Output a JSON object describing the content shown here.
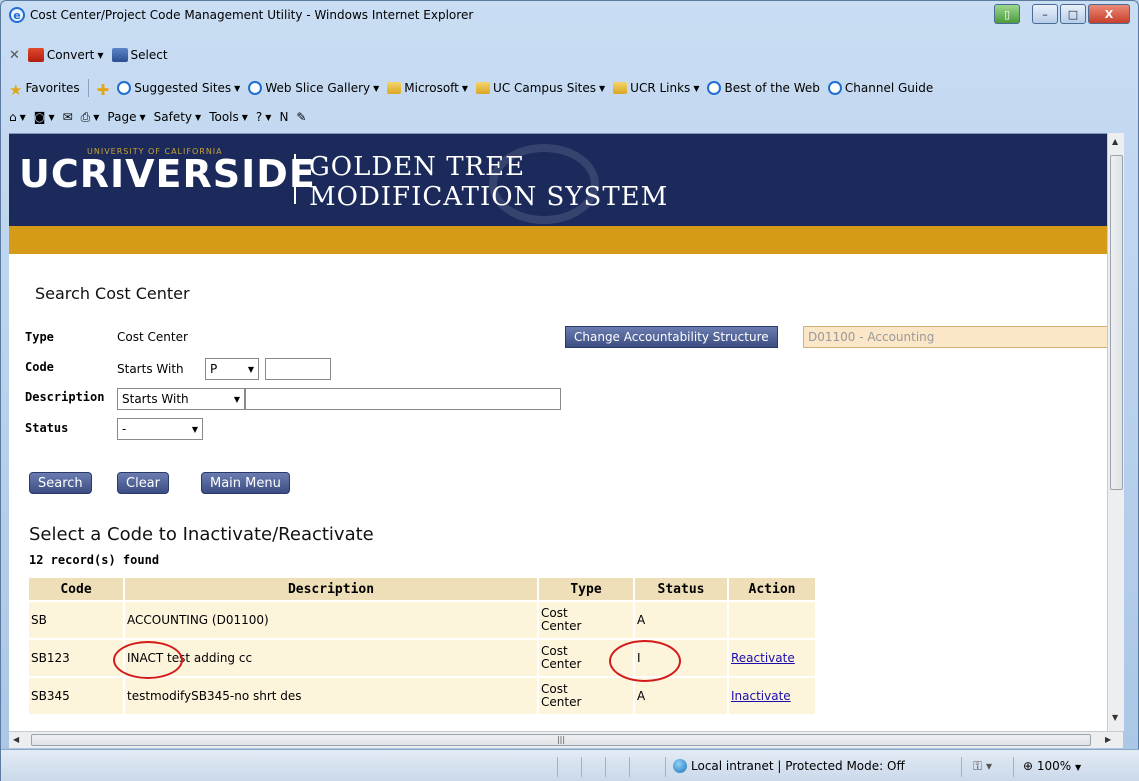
{
  "window": {
    "title": "Cost Center/Project Code Management Utility - Windows Internet Explorer",
    "btn_minimize": "–",
    "btn_maximize": "□",
    "btn_close": "X"
  },
  "toolbar": {
    "convert": "Convert",
    "select": "Select"
  },
  "favorites_bar": {
    "favorites": "Favorites",
    "items": [
      "Suggested Sites",
      "Web Slice Gallery",
      "Microsoft",
      "UC Campus Sites",
      "UCR Links",
      "Best of the Web",
      "Channel Guide"
    ]
  },
  "command_bar": {
    "page": "Page",
    "safety": "Safety",
    "tools": "Tools"
  },
  "banner": {
    "logo_uc": "UCRIVERSIDE",
    "logo_small": "UNIVERSITY OF CALIFORNIA",
    "system_line1": "GOLDEN TREE",
    "system_line2": "MODIFICATION SYSTEM"
  },
  "search": {
    "heading": "Search Cost Center",
    "type_label": "Type",
    "type_value": "Cost Center",
    "code_label": "Code",
    "code_prefix": "Starts With",
    "code_select": "P",
    "description_label": "Description",
    "description_select": "Starts With",
    "status_label": "Status",
    "status_select": "-",
    "btn_search": "Search",
    "btn_clear": "Clear",
    "btn_main_menu": "Main Menu",
    "btn_change_structure": "Change Accountability Structure",
    "structure_value": "D01100 - Accounting"
  },
  "results": {
    "heading": "Select a Code to Inactivate/Reactivate",
    "found": "12 record(s) found",
    "columns": [
      "Code",
      "Description",
      "Type",
      "Status",
      "Action"
    ],
    "rows": [
      {
        "code": "SB",
        "description": "ACCOUNTING (D01100)",
        "type_line1": "Cost",
        "type_line2": "Center",
        "status": "A",
        "action": ""
      },
      {
        "code": "SB123",
        "description": "INACT test adding cc",
        "type_line1": "Cost",
        "type_line2": "Center",
        "status": "I",
        "action": "Reactivate"
      },
      {
        "code": "SB345",
        "description": "testmodifySB345-no shrt des",
        "type_line1": "Cost",
        "type_line2": "Center",
        "status": "A",
        "action": "Inactivate"
      }
    ]
  },
  "statusbar": {
    "zone": "Local intranet | Protected Mode: Off",
    "zoom": "100%"
  }
}
